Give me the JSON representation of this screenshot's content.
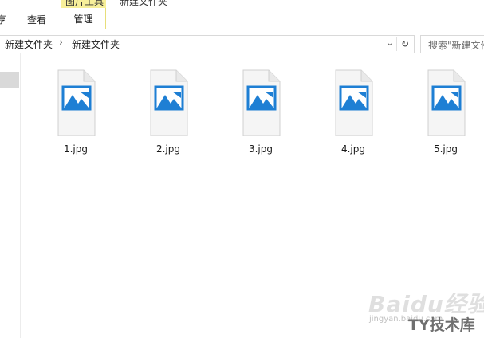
{
  "ribbon": {
    "context_group_label": "图片工具",
    "window_title": "新建文件夹",
    "tabs": [
      "享",
      "查看",
      "管理"
    ]
  },
  "address_bar": {
    "breadcrumbs": [
      "新建文件夹",
      "新建文件夹"
    ],
    "separator": "›",
    "dropdown_glyph": "⌄",
    "refresh_glyph": "↻"
  },
  "search": {
    "placeholder": "搜索\"新建文件夹\""
  },
  "files": [
    {
      "name": "1.jpg",
      "icon": "image-file-icon"
    },
    {
      "name": "2.jpg",
      "icon": "image-file-icon"
    },
    {
      "name": "3.jpg",
      "icon": "image-file-icon"
    },
    {
      "name": "4.jpg",
      "icon": "image-file-icon"
    },
    {
      "name": "5.jpg",
      "icon": "image-file-icon"
    }
  ],
  "watermark": {
    "logo": "Baidu经验",
    "sub": "jingyan.baidu.com",
    "overlay": "TY技术库"
  },
  "colors": {
    "context_tab": "#f7ef9a",
    "image_icon_blue": "#1e7fd4",
    "nav_selected": "#d9d9d9"
  }
}
